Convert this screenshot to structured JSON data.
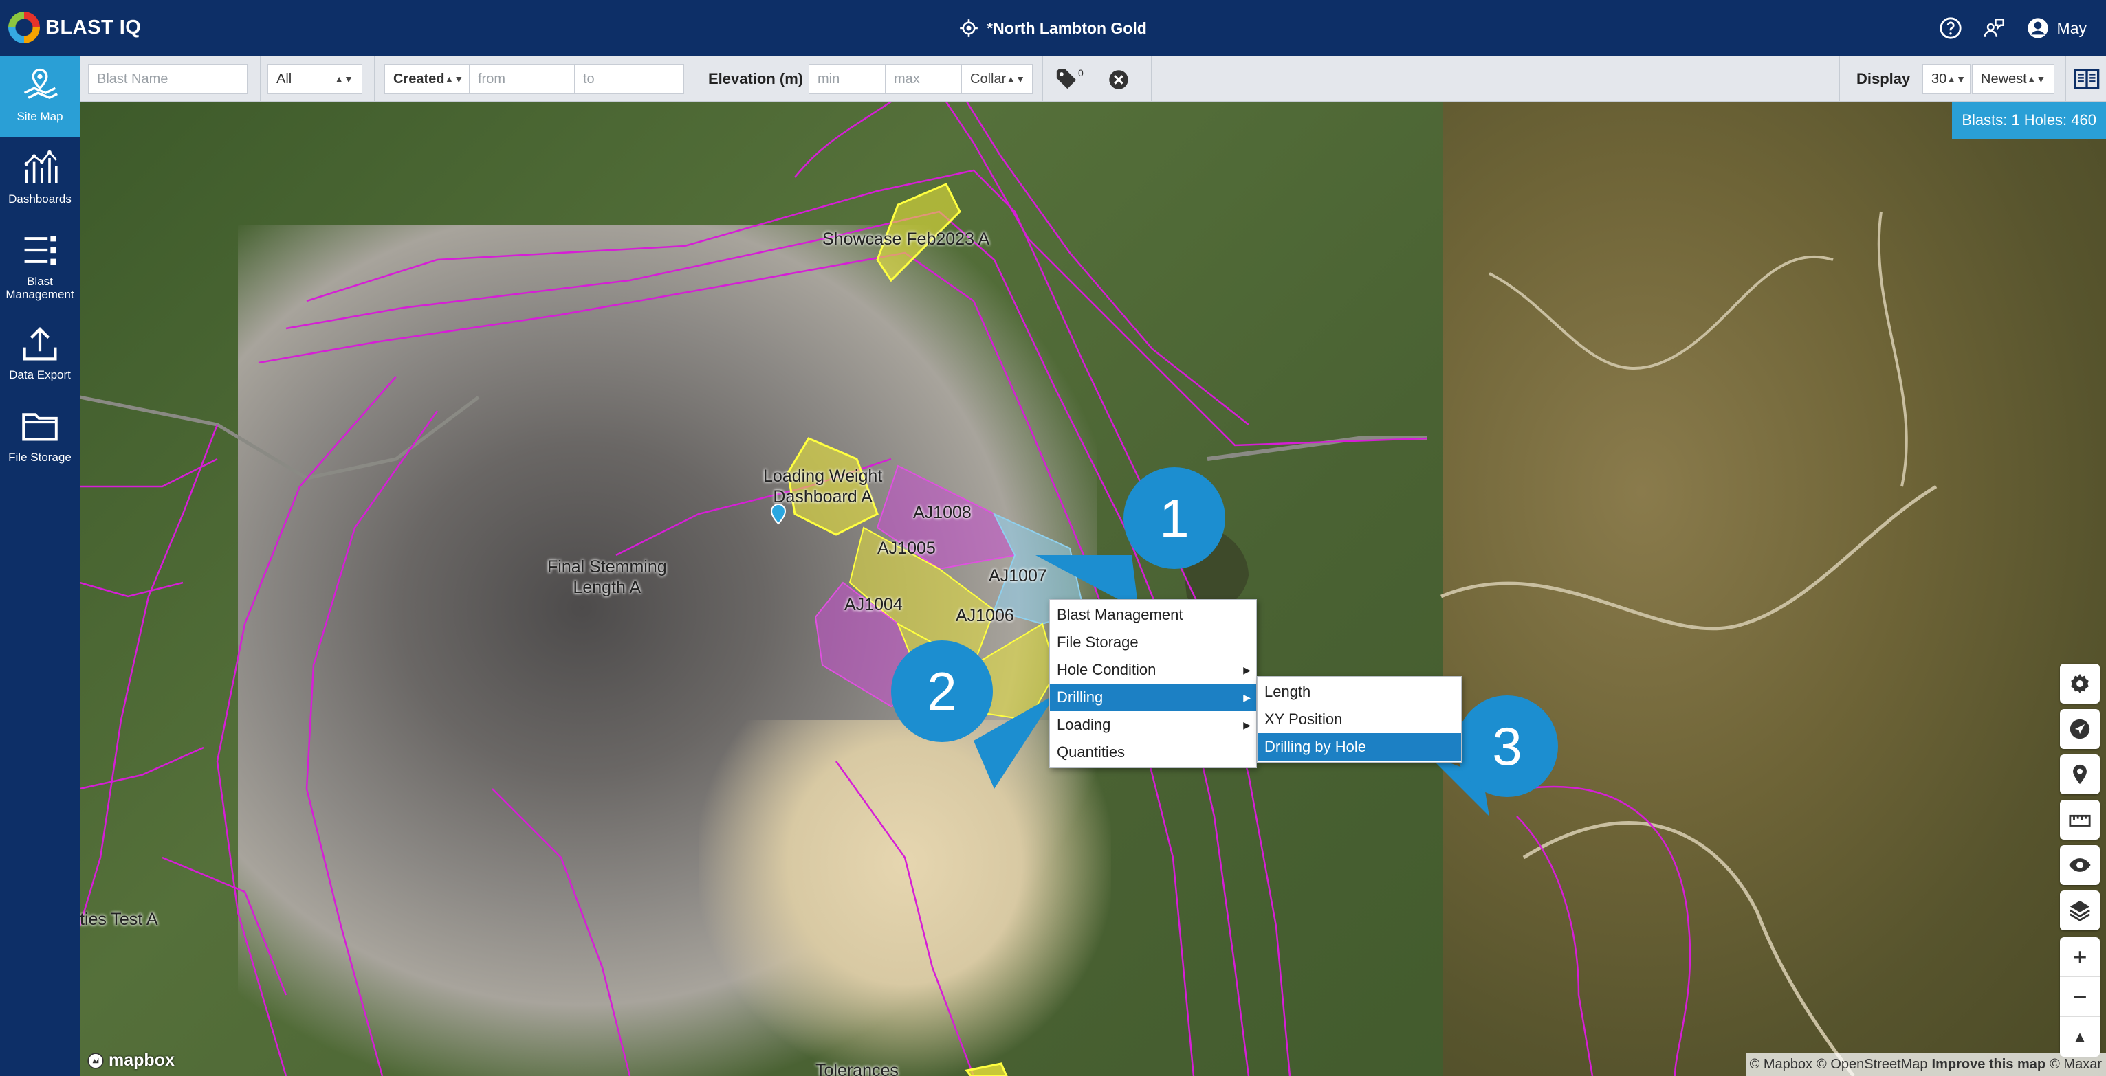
{
  "header": {
    "logo_text": "BLAST IQ",
    "site_title": "*North Lambton Gold",
    "user_name": "May",
    "help_icon": "help-circle-icon",
    "chat_icon": "feedback-icon",
    "user_icon": "account-icon"
  },
  "sidebar": {
    "items": [
      {
        "label": "Site Map",
        "icon": "map-icon",
        "active": true
      },
      {
        "label": "Dashboards",
        "icon": "chart-icon",
        "active": false
      },
      {
        "label": "Blast Management",
        "icon": "list-icon",
        "active": false
      },
      {
        "label": "Data Export",
        "icon": "upload-icon",
        "active": false
      },
      {
        "label": "File Storage",
        "icon": "folder-icon",
        "active": false
      }
    ]
  },
  "filters": {
    "blast_name_placeholder": "Blast Name",
    "status_value": "All",
    "date_type_value": "Created",
    "from_placeholder": "from",
    "to_placeholder": "to",
    "elevation_label": "Elevation (m)",
    "min_placeholder": "min",
    "max_placeholder": "max",
    "elevation_ref_value": "Collar",
    "tag_count": "0",
    "display_label": "Display",
    "display_count_value": "30",
    "sort_value": "Newest"
  },
  "map": {
    "badge": "Blasts: 1 Holes: 460",
    "labels": {
      "showcase": "Showcase Feb2023 A",
      "loading_weight_1": "Loading Weight",
      "loading_weight_2": "Dashboard A",
      "final_stemming_1": "Final Stemming",
      "final_stemming_2": "Length A",
      "aj1008": "AJ1008",
      "aj1005": "AJ1005",
      "aj1007": "AJ1007",
      "aj1004": "AJ1004",
      "aj1006": "AJ1006",
      "quantities_test": "ties Test A",
      "tolerances": "Tolerances"
    },
    "callouts": [
      "1",
      "2",
      "3"
    ],
    "attribution": {
      "mapbox": "© Mapbox",
      "osm": "© OpenStreetMap",
      "improve": "Improve this map",
      "maxar": "© Maxar"
    },
    "mapbox_logo": "mapbox"
  },
  "context_menu": {
    "items": [
      {
        "label": "Blast Management",
        "has_sub": false,
        "selected": false
      },
      {
        "label": "File Storage",
        "has_sub": false,
        "selected": false
      },
      {
        "label": "Hole Condition",
        "has_sub": true,
        "selected": false
      },
      {
        "label": "Drilling",
        "has_sub": true,
        "selected": true
      },
      {
        "label": "Loading",
        "has_sub": true,
        "selected": false
      },
      {
        "label": "Quantities",
        "has_sub": false,
        "selected": false
      }
    ]
  },
  "submenu": {
    "items": [
      {
        "label": "Length",
        "selected": false
      },
      {
        "label": "XY Position",
        "selected": false
      },
      {
        "label": "Drilling by Hole",
        "selected": true
      }
    ]
  },
  "map_controls": {
    "icons": [
      "settings-icon",
      "navigate-icon",
      "location-pin-icon",
      "ruler-icon",
      "eye-icon",
      "layers-icon"
    ],
    "zoom_in": "+",
    "zoom_out": "−",
    "compass": "▲"
  },
  "colors": {
    "nav_bg": "#0d2f67",
    "accent": "#2a9fd6",
    "menu_selected": "#1c80c4",
    "boundary": "#d61ed6",
    "blast_yellow": "#e8e23a",
    "blast_magenta": "#c64fd0",
    "blast_blue": "#8fd0ee"
  }
}
